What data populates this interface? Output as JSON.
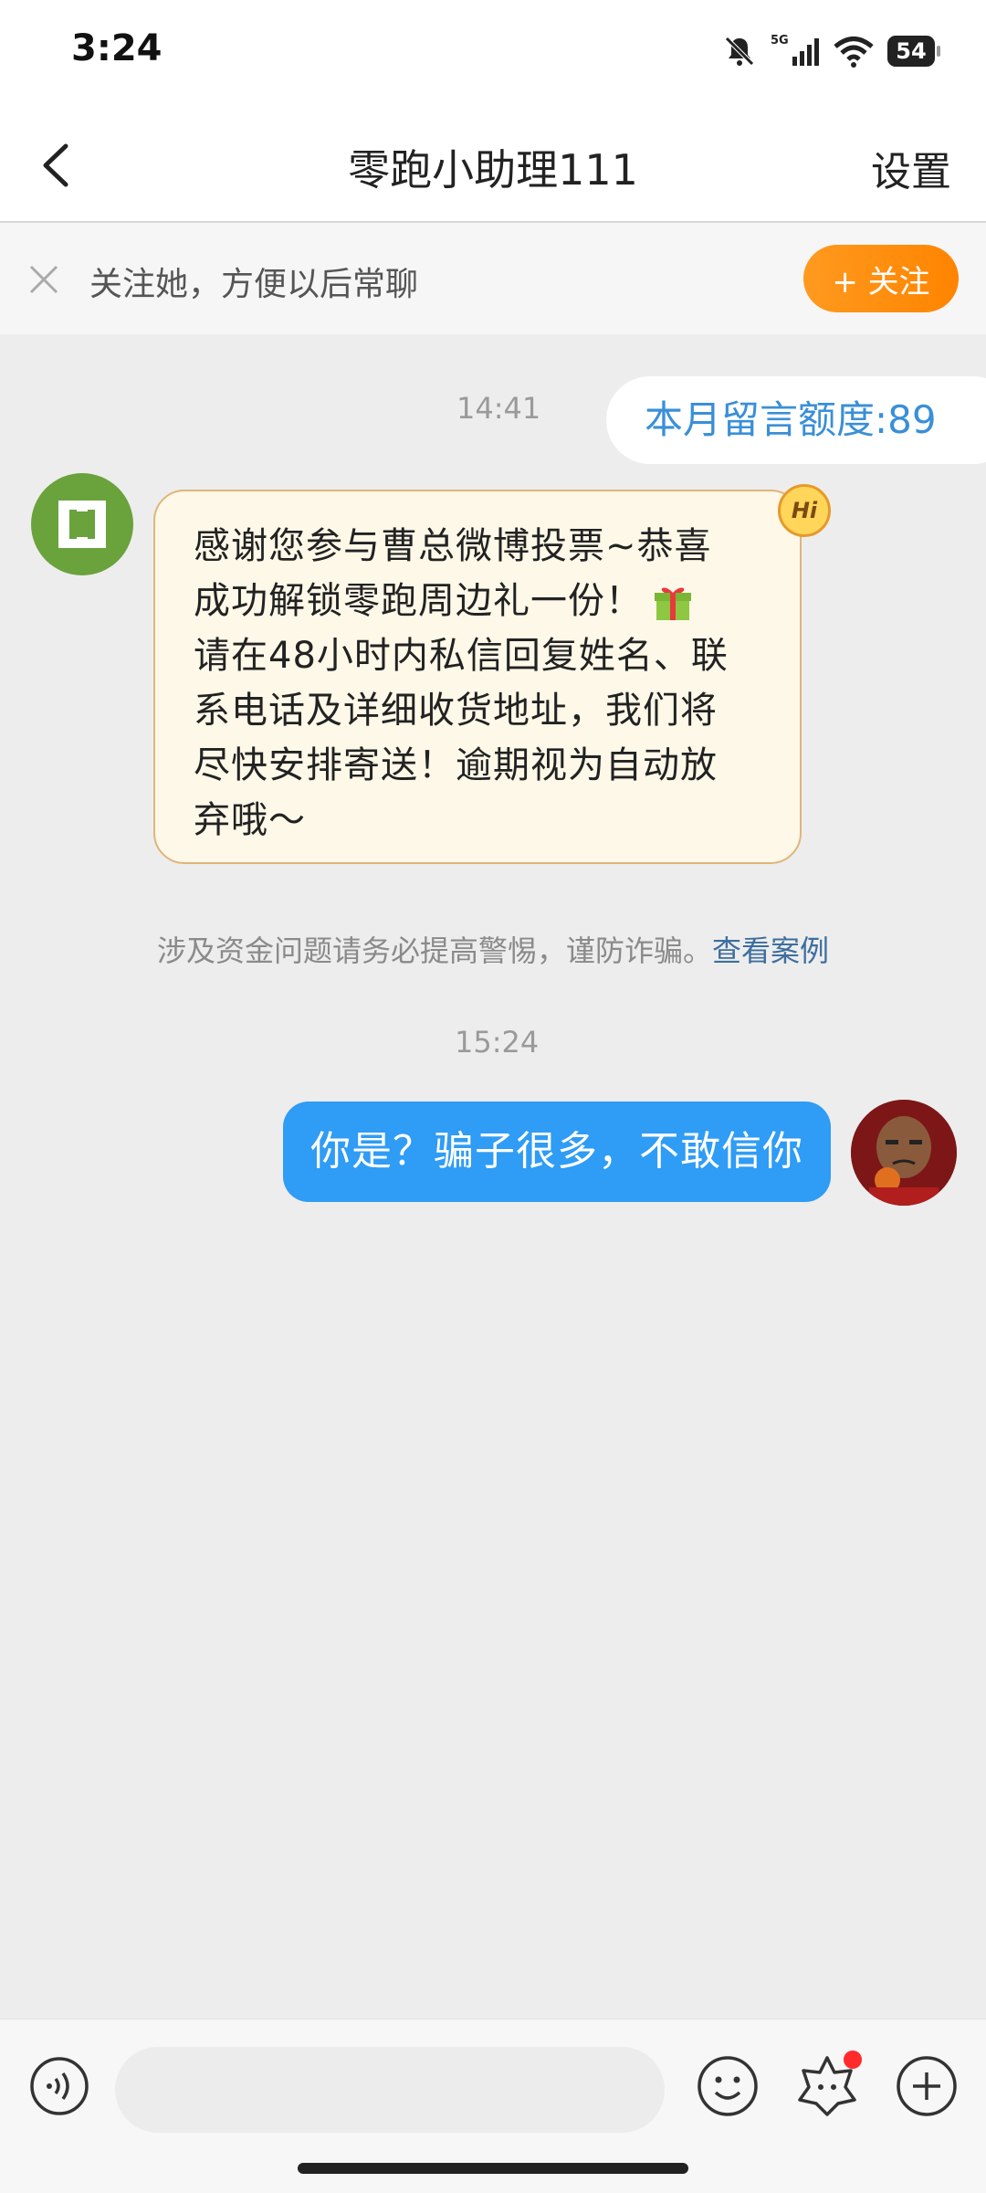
{
  "status_bar": {
    "time": "3:24",
    "network": "5G",
    "battery": "54"
  },
  "nav": {
    "title": "零跑小助理111",
    "settings_label": "设置"
  },
  "follow_bar": {
    "text": "关注她，方便以后常聊",
    "button_label": "+ 关注"
  },
  "messages": {
    "ts1": "14:41",
    "quota": "本月留言额度:89",
    "bot_lines": [
      "感谢您参与曹总微博投票~恭喜",
      "成功解锁零跑周边礼一份！",
      "请在48小时内私信回复姓名、联",
      "系电话及详细收货地址，我们将",
      "尽快安排寄送！逾期视为自动放",
      "弃哦～"
    ],
    "hi_badge": "Hi",
    "warning_text": "涉及资金问题请务必提高警惕，谨防诈骗。",
    "warning_link": "查看案例",
    "ts2": "15:24",
    "my_message": "你是？骗子很多，不敢信你"
  },
  "icons": {
    "back": "chevron-left-icon",
    "close": "close-icon",
    "gift": "gift-icon",
    "voice": "voice-icon",
    "emoji": "emoji-icon",
    "sticker": "sticker-icon",
    "plus": "plus-icon"
  },
  "colors": {
    "accent_orange": "#ff8a00",
    "bubble_blue": "#2f9cf5",
    "link_blue": "#3d6e9e",
    "quota_blue": "#3a8fd8",
    "bot_bubble_bg": "#fdf8e8",
    "background": "#ededed"
  }
}
